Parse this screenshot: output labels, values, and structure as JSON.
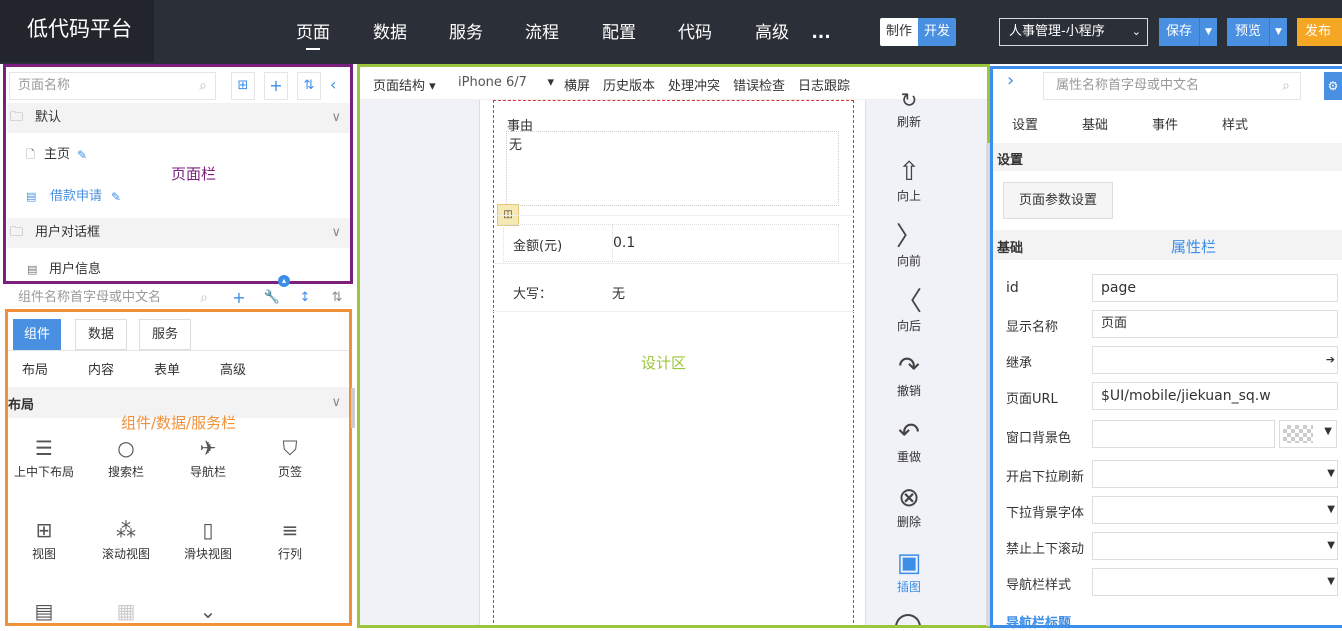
{
  "app": {
    "title": "低代码平台"
  },
  "top_nav": [
    {
      "label": "页面",
      "active": true
    },
    {
      "label": "数据"
    },
    {
      "label": "服务"
    },
    {
      "label": "流程"
    },
    {
      "label": "配置"
    },
    {
      "label": "代码"
    },
    {
      "label": "高级"
    },
    {
      "label": "..."
    }
  ],
  "mode_toggle": {
    "make": "制作",
    "dev": "开发"
  },
  "project_select": {
    "value": "人事管理-小程序"
  },
  "actions": {
    "save": "保存",
    "preview": "预览",
    "publish": "发布"
  },
  "page_panel": {
    "search_placeholder": "页面名称",
    "overlay_label": "页面栏",
    "folders": [
      {
        "name": "默认",
        "pages": [
          {
            "label": "主页"
          },
          {
            "label": "借款申请",
            "selected": true
          }
        ]
      },
      {
        "name": "用户对话框",
        "pages": [
          {
            "label": "用户信息"
          }
        ]
      }
    ]
  },
  "component_panel": {
    "search_placeholder": "组件名称首字母或中文名",
    "overlay_label": "组件/数据/服务栏",
    "tabs": [
      "组件",
      "数据",
      "服务"
    ],
    "sub_tabs": [
      "布局",
      "内容",
      "表单",
      "高级"
    ],
    "section": "布局",
    "items": [
      {
        "label": "上中下布局",
        "icon": "layers-icon"
      },
      {
        "label": "搜索栏",
        "icon": "search-icon"
      },
      {
        "label": "导航栏",
        "icon": "paper-plane-icon"
      },
      {
        "label": "页签",
        "icon": "bookmark-icon"
      },
      {
        "label": "视图",
        "icon": "grid-icon"
      },
      {
        "label": "滚动视图",
        "icon": "shapes-icon"
      },
      {
        "label": "滑块视图",
        "icon": "slider-icon"
      },
      {
        "label": "行列",
        "icon": "list-icon"
      }
    ]
  },
  "design_toolbar": {
    "items": [
      "页面结构",
      "iPhone 6/7",
      "横屏",
      "历史版本",
      "处理冲突",
      "错误检查",
      "日志跟踪"
    ]
  },
  "design_area": {
    "overlay_label": "设计区",
    "form": {
      "reason_label": "事由",
      "reason_value": "无",
      "amount_label": "金额(元)",
      "amount_value": "0.1",
      "upper_label": "大写：",
      "upper_value": "无"
    }
  },
  "side_tools": [
    {
      "label": "刷新",
      "icon": "refresh-icon"
    },
    {
      "label": "向上",
      "icon": "arrow-up-icon"
    },
    {
      "label": "向前",
      "icon": "chevron-right-icon"
    },
    {
      "label": "向后",
      "icon": "chevron-left-icon"
    },
    {
      "label": "撤销",
      "icon": "redo-arrow-icon"
    },
    {
      "label": "重做",
      "icon": "undo-arrow-icon"
    },
    {
      "label": "删除",
      "icon": "delete-circle-icon"
    },
    {
      "label": "插图",
      "icon": "image-icon"
    }
  ],
  "property_panel": {
    "search_placeholder": "属性名称首字母或中文名",
    "overlay_label": "属性栏",
    "tabs": [
      "设置",
      "基础",
      "事件",
      "样式"
    ],
    "section_settings": "设置",
    "param_button": "页面参数设置",
    "section_basic": "基础",
    "fields": [
      {
        "label": "id",
        "value": "page"
      },
      {
        "label": "显示名称",
        "value": "页面"
      },
      {
        "label": "继承",
        "value": ""
      },
      {
        "label": "页面URL",
        "value": "$UI/mobile/jiekuan_sq.w"
      },
      {
        "label": "窗口背景色",
        "value": ""
      },
      {
        "label": "开启下拉刷新",
        "value": ""
      },
      {
        "label": "下拉背景字体",
        "value": ""
      },
      {
        "label": "禁止上下滚动",
        "value": ""
      },
      {
        "label": "导航栏样式",
        "value": ""
      }
    ],
    "next_section": "导航栏标题"
  },
  "colors": {
    "page_box": "#7a1f7e",
    "component_box": "#f0913a",
    "design_box": "#9bc53d",
    "property_box": "#3c8ee8",
    "accent": "#4a90e2",
    "publish": "#f5a623"
  }
}
